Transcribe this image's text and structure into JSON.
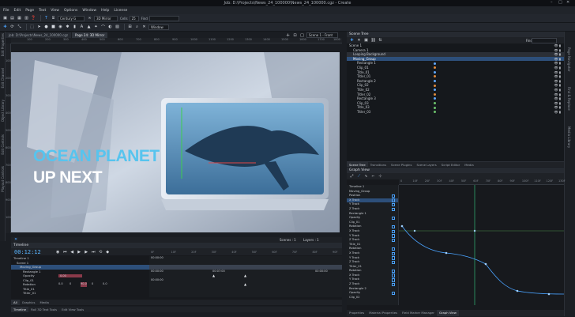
{
  "window": {
    "title": "Job: D:\\Projects\\News_24_100000\\News_24_100000.cgz - Create",
    "controls": [
      "–",
      "□",
      "✕"
    ]
  },
  "menu": [
    "File",
    "Edit",
    "Page",
    "Text",
    "View",
    "Options",
    "Window",
    "Help",
    "License"
  ],
  "toolbar": {
    "font_select": "Century G",
    "view_mode": "3D Mirror",
    "cells_label": "Cells",
    "cells_value": "25",
    "find_label": "Find",
    "window_label": "Window"
  },
  "document_tabs": [
    "Job: D:\\Projects\\News_24_100000.cgz",
    "Page 24: 3D Mirror"
  ],
  "canvas_toolbar": {
    "scene_label": "Scene 1 - Front"
  },
  "left_panel_labels": [
    "Edit Properties",
    "Edit Channel",
    "Object Library",
    "Edit Controls",
    "Playout Controls"
  ],
  "right_panel_labels": [
    "Page Navigator",
    "Find & Replace",
    "Media Library"
  ],
  "ruler_h": [
    "100",
    "200",
    "300",
    "400",
    "500",
    "600",
    "700",
    "800",
    "900",
    "1000",
    "1100",
    "1200",
    "1300",
    "1400",
    "1500",
    "1600",
    "1700",
    "1800"
  ],
  "ruler_v": [
    "100",
    "200",
    "300",
    "400",
    "500",
    "600",
    "700",
    "800",
    "900",
    "1000"
  ],
  "canvas": {
    "headline_1": "OCEAN PLANET",
    "headline_2": "UP NEXT"
  },
  "canvas_status": {
    "scenes": "Scenes : 1",
    "layers": "Layers : 1"
  },
  "scene_tree": {
    "title": "Scene Tree",
    "find_label": "Find",
    "items": [
      {
        "label": "Scene 1",
        "indent": 0,
        "state": "",
        "dot": ""
      },
      {
        "label": "Camera 1",
        "indent": 1,
        "state": "",
        "dot": ""
      },
      {
        "label": "Looping Background",
        "indent": 1,
        "state": "hl",
        "dot": ""
      },
      {
        "label": "Moving_Group",
        "indent": 1,
        "state": "sel",
        "dot": ""
      },
      {
        "label": "Rectangle 1",
        "indent": 2,
        "state": "",
        "dot": "#5fa8ff"
      },
      {
        "label": "Clip_01",
        "indent": 2,
        "state": "",
        "dot": "#e08a3a"
      },
      {
        "label": "Title_01",
        "indent": 2,
        "state": "",
        "dot": "#5fa8ff"
      },
      {
        "label": "Titler_01",
        "indent": 2,
        "state": "",
        "dot": "#e08a3a"
      },
      {
        "label": "Rectangle 2",
        "indent": 2,
        "state": "",
        "dot": "#5fa8ff"
      },
      {
        "label": "Clip_02",
        "indent": 2,
        "state": "",
        "dot": "#e08a3a"
      },
      {
        "label": "Title_02",
        "indent": 2,
        "state": "",
        "dot": "#5fa8ff"
      },
      {
        "label": "Titler_02",
        "indent": 2,
        "state": "",
        "dot": "#e08a3a"
      },
      {
        "label": "Rectangle 3",
        "indent": 2,
        "state": "",
        "dot": "#5fa8ff"
      },
      {
        "label": "Clip_03",
        "indent": 2,
        "state": "",
        "dot": "#6cc36c"
      },
      {
        "label": "Title_03",
        "indent": 2,
        "state": "",
        "dot": "#6cc36c"
      },
      {
        "label": "Titler_03",
        "indent": 2,
        "state": "",
        "dot": "#6cc36c"
      }
    ],
    "eye_glyph": "👁 ▮"
  },
  "scene_tree_tabs": [
    "Scene Tree",
    "Transitions",
    "Scene Plugins",
    "Scene Layers",
    "Script Editor",
    "Media"
  ],
  "graph_view": {
    "title": "Graph View",
    "rows": [
      {
        "label": "Timeline 1",
        "state": "",
        "check": false
      },
      {
        "label": "Moving_Group",
        "state": "",
        "check": false
      },
      {
        "label": "Position",
        "state": "",
        "check": true
      },
      {
        "label": "X Track",
        "state": "sel",
        "check": true
      },
      {
        "label": "Y Track",
        "state": "",
        "check": true
      },
      {
        "label": "Z Track",
        "state": "",
        "check": true
      },
      {
        "label": "Rectangle 1",
        "state": "",
        "check": false
      },
      {
        "label": "Opacity",
        "state": "",
        "check": true
      },
      {
        "label": "Clip_01",
        "state": "",
        "check": false
      },
      {
        "label": "Rotation",
        "state": "",
        "check": true
      },
      {
        "label": "X Track",
        "state": "",
        "check": true
      },
      {
        "label": "Y Track",
        "state": "",
        "check": true
      },
      {
        "label": "Z Track",
        "state": "",
        "check": true
      },
      {
        "label": "Title_01",
        "state": "",
        "check": false
      },
      {
        "label": "Rotation",
        "state": "",
        "check": true
      },
      {
        "label": "X Track",
        "state": "",
        "check": true
      },
      {
        "label": "Y Track",
        "state": "",
        "check": true
      },
      {
        "label": "Z Track",
        "state": "",
        "check": true
      },
      {
        "label": "Titler_01",
        "state": "",
        "check": false
      },
      {
        "label": "Rotation",
        "state": "",
        "check": true
      },
      {
        "label": "X Track",
        "state": "",
        "check": true
      },
      {
        "label": "Y Track",
        "state": "",
        "check": true
      },
      {
        "label": "Z Track",
        "state": "",
        "check": true
      },
      {
        "label": "Rectangle 2",
        "state": "",
        "check": false
      },
      {
        "label": "Opacity",
        "state": "",
        "check": true
      },
      {
        "label": "Clip_02",
        "state": "",
        "check": false
      }
    ],
    "ruler": [
      "0",
      "10F",
      "20F",
      "30F",
      "40F",
      "50F",
      "60F",
      "70F",
      "80F",
      "90F",
      "100F",
      "110F",
      "120F",
      "130F"
    ]
  },
  "bottom_right_tabs": [
    "Properties",
    "Material Properties",
    "Field Marker Manager",
    "Graph View"
  ],
  "timeline": {
    "title": "Timeline",
    "timecode": "00:12:12",
    "rows": [
      {
        "label": "Timeline 1",
        "state": ""
      },
      {
        "label": "Scene 1",
        "state": ""
      },
      {
        "label": "Moving_Group",
        "state": "sel"
      },
      {
        "label": "Rectangle 1",
        "state": ""
      },
      {
        "label": "Opacity",
        "state": ""
      },
      {
        "label": "Clip_01",
        "state": ""
      },
      {
        "label": "Rotation",
        "state": ""
      },
      {
        "label": "Title_01",
        "state": ""
      },
      {
        "label": "Titler_01",
        "state": ""
      }
    ],
    "opacity_value": "0.00",
    "rot_values": [
      "0.0",
      "0",
      "90.0",
      "0",
      "0.0"
    ],
    "timecodes": [
      "00:00:00",
      "00:00:00",
      "00:00:00",
      "00:07:00",
      "00:00:00"
    ],
    "ruler": [
      "0F",
      "10F",
      "20F",
      "30F",
      "40F",
      "50F",
      "60F",
      "70F",
      "80F",
      "90F"
    ],
    "bottom_tabs": [
      "All",
      "Graphics",
      "Media"
    ]
  },
  "bottom_left_tabs": [
    "Timeline",
    "Roll 3D Text Tools",
    "Edit View Tools"
  ]
}
